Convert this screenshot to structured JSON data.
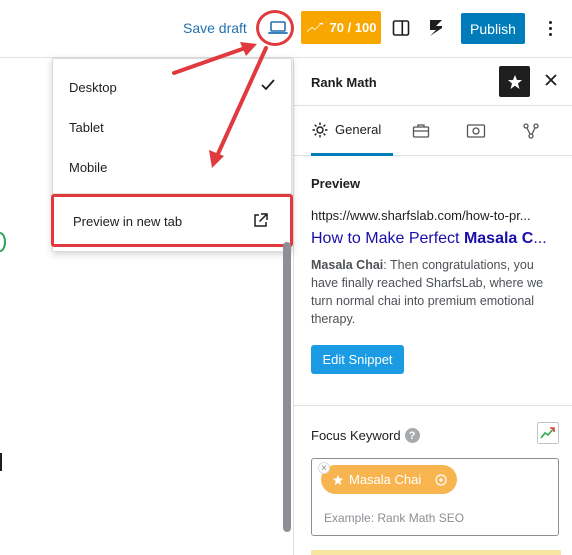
{
  "toolbar": {
    "save_draft": "Save draft",
    "device_icon": "laptop-icon",
    "score": "70 / 100",
    "score_icon": "rank-math-logo-icon",
    "publish": "Publish",
    "colors": {
      "accent": "#007cba",
      "score_bg": "#f8a700",
      "highlight": "#e0393e"
    }
  },
  "preview_menu": {
    "items": [
      {
        "label": "Desktop",
        "checked": true
      },
      {
        "label": "Tablet",
        "checked": false
      },
      {
        "label": "Mobile",
        "checked": false
      }
    ],
    "new_tab": {
      "label": "Preview in new tab",
      "icon": "external-link-icon"
    }
  },
  "sidebar": {
    "title": "Rank Math",
    "tabs": [
      {
        "label": "General",
        "icon": "gear-icon",
        "active": true
      },
      {
        "label": "",
        "icon": "briefcase-icon"
      },
      {
        "label": "",
        "icon": "image-icon"
      },
      {
        "label": "",
        "icon": "schema-icon"
      }
    ],
    "preview": {
      "heading": "Preview",
      "url": "https://www.sharfslab.com/how-to-pr...",
      "title_prefix": "How to Make Perfect ",
      "title_keyword": "Masala C",
      "title_suffix": "...",
      "desc_keyword": "Masala Chai",
      "desc_rest": ": Then congratulations, you have finally reached SharfsLab, where we turn normal chai into premium emotional therapy.",
      "edit_button": "Edit Snippet"
    },
    "focus_keyword": {
      "label": "Focus Keyword",
      "help": "?",
      "keyword": "Masala Chai",
      "remove": "×",
      "placeholder": "Example: Rank Math SEO"
    }
  }
}
